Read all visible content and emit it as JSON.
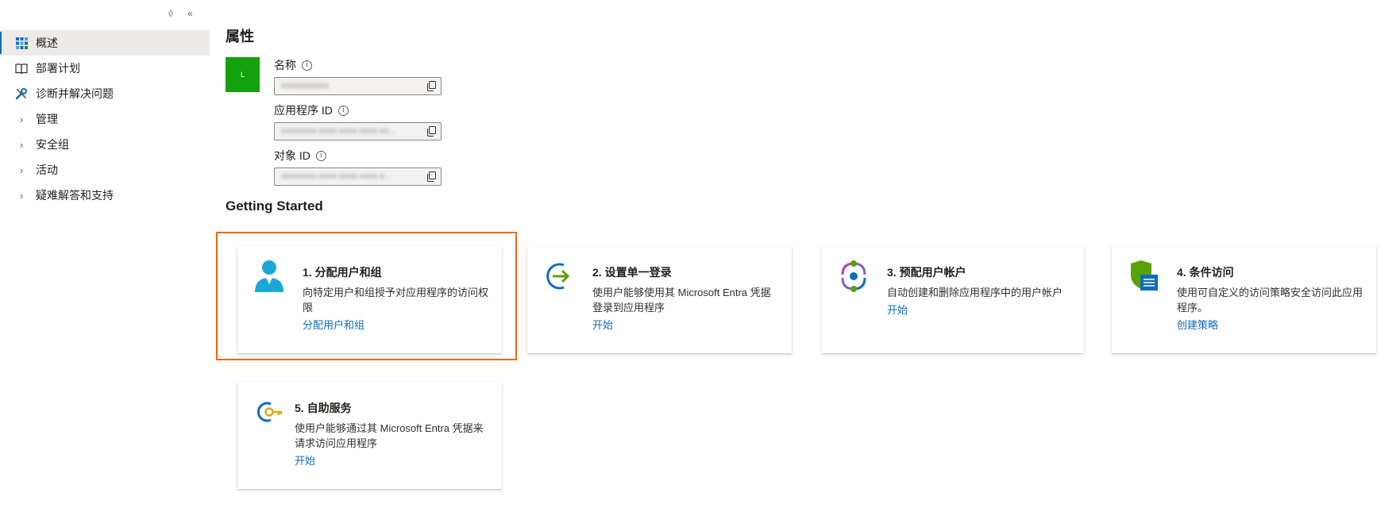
{
  "sidebar": {
    "tools": {
      "sort": "◊",
      "collapse": "«"
    },
    "items": [
      {
        "label": "概述",
        "icon": "grid-icon",
        "active": true
      },
      {
        "label": "部署计划",
        "icon": "book-icon"
      },
      {
        "label": "诊断并解决问题",
        "icon": "wrench-icon"
      },
      {
        "label": "管理",
        "expandable": true
      },
      {
        "label": "安全组",
        "expandable": true
      },
      {
        "label": "活动",
        "expandable": true
      },
      {
        "label": "疑难解答和支持",
        "expandable": true
      }
    ]
  },
  "properties": {
    "title": "属性",
    "logo_text": "L",
    "name_label": "名称",
    "name_value": "xxxxxxxxxxx",
    "app_id_label": "应用程序 ID",
    "app_id_value": "xxxxxxxx-xxxx-xxxx-xxxx-xx...",
    "object_id_label": "对象 ID",
    "object_id_value": "xxxxxxxx-xxxx-xxxx-xxxx-x..."
  },
  "getting_started": {
    "title": "Getting Started",
    "cards": [
      {
        "title": "1. 分配用户和组",
        "desc": "向特定用户和组授予对应用程序的访问权限",
        "link": "分配用户和组",
        "icon": "user-icon"
      },
      {
        "title": "2. 设置单一登录",
        "desc": "使用户能够使用其 Microsoft Entra 凭据登录到应用程序",
        "link": "开始",
        "icon": "sign-in-icon"
      },
      {
        "title": "3. 预配用户帐户",
        "desc": "自动创建和删除应用程序中的用户帐户",
        "link": "开始",
        "icon": "provisioning-icon"
      },
      {
        "title": "4. 条件访问",
        "desc": "使用可自定义的访问策略安全访问此应用程序。",
        "link": "创建策略",
        "icon": "shield-icon"
      },
      {
        "title": "5. 自助服务",
        "desc": "使用户能够通过其 Microsoft Entra 凭据来请求访问应用程序",
        "link": "开始",
        "icon": "key-icon"
      }
    ]
  },
  "colors": {
    "accent": "#0f6cbd",
    "highlight": "#f7630c",
    "logo": "#13a10e"
  }
}
